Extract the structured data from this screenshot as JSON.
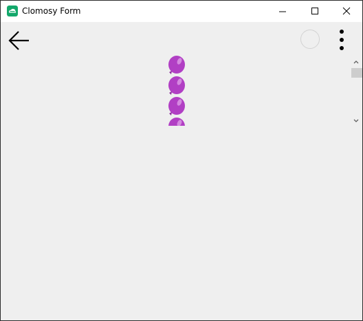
{
  "window": {
    "title": "Clomosy Form",
    "icon": "clomosy-app-icon",
    "controls": [
      "minimize-icon",
      "maximize-icon",
      "close-icon"
    ]
  },
  "toolbar": {
    "back_icon": "arrow-left-icon",
    "status_icon": "circle-outline-icon",
    "menu_icon": "vertical-dots-icon"
  },
  "content": {
    "balloon_icon": "balloon-icon",
    "balloon_color": "#b13fc4",
    "visible_balloons": 4
  },
  "scrollbar": {
    "up_icon": "chevron-up-icon",
    "down_icon": "chevron-down-icon"
  },
  "colors": {
    "background": "#efefef",
    "titlebar": "#ffffff",
    "accent": "#13a86b"
  }
}
